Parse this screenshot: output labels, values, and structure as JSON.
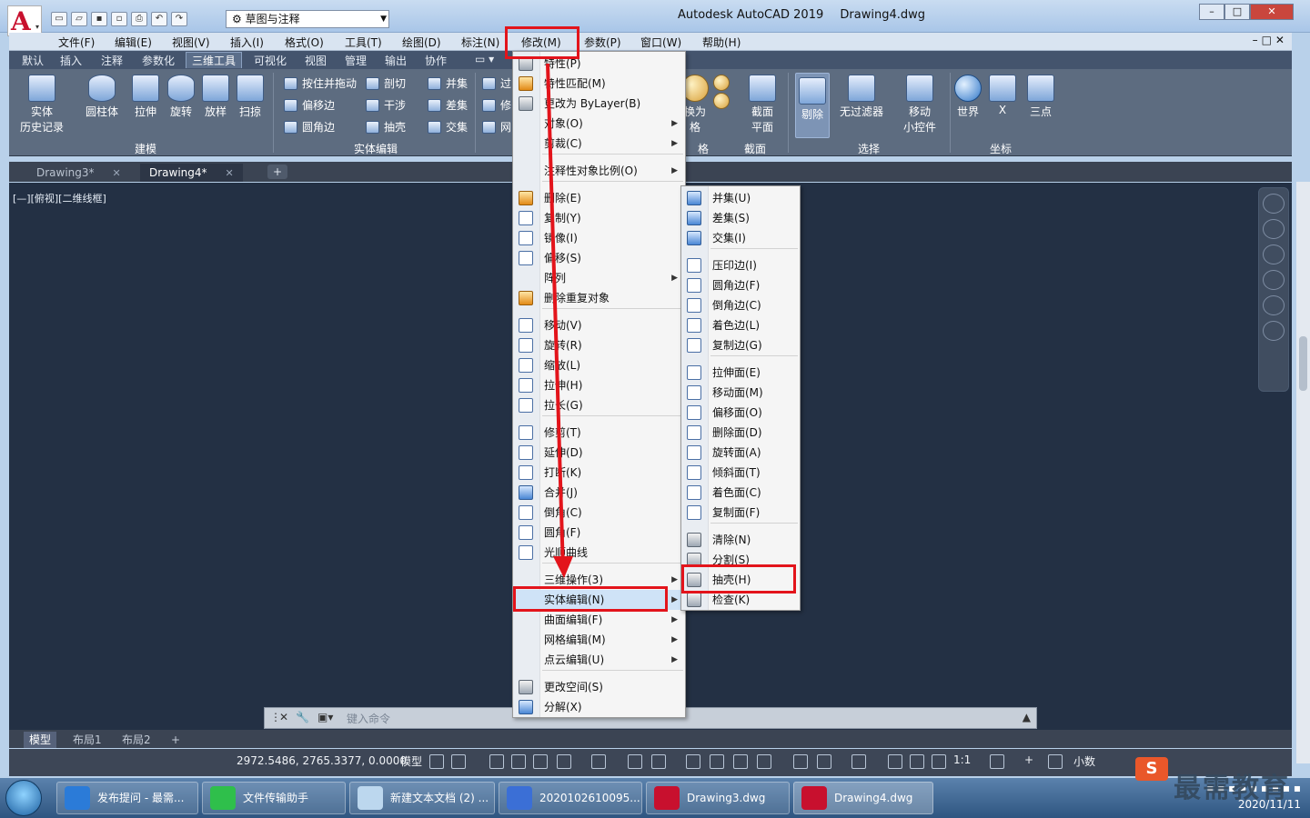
{
  "title_bar": {
    "workspace": "草图与注释",
    "app_title": "Autodesk AutoCAD 2019",
    "doc_title": "Drawing4.dwg"
  },
  "menubar": [
    "文件(F)",
    "编辑(E)",
    "视图(V)",
    "插入(I)",
    "格式(O)",
    "工具(T)",
    "绘图(D)",
    "标注(N)",
    "修改(M)",
    "参数(P)",
    "窗口(W)",
    "帮助(H)"
  ],
  "ribbon_tabs": [
    "默认",
    "插入",
    "注释",
    "参数化",
    "三维工具",
    "可视化",
    "视图",
    "管理",
    "输出",
    "协作"
  ],
  "ribbon": {
    "buttons": {
      "history": "实体\n历史记录",
      "cylinder": "圆柱体",
      "extrude": "拉伸",
      "revolve": "旋转",
      "loft": "放样",
      "sweep": "扫掠",
      "section_plane": "截面\n平面",
      "cull": "剔除",
      "no_filter": "无过滤器",
      "move_gizmo": "移动\n小控件",
      "world": "世界",
      "x": "X",
      "three_point": "三点",
      "convert_partial": "换为\n格"
    },
    "small": {
      "presspull": "按住并拖动",
      "offset_edge": "偏移边",
      "fillet_edge": "圆角边",
      "slice": "剖切",
      "interfere": "干涉",
      "shell": "抽壳",
      "union": "并集",
      "subtract": "差集",
      "intersect": "交集",
      "extract_a": "过",
      "extract_b": "修",
      "extract_c": "网"
    },
    "panels": {
      "modeling": "建模",
      "solid_edit": "实体编辑",
      "grid": "格",
      "section": "截面",
      "selection": "选择",
      "coordinates": "坐标"
    }
  },
  "doc_tabs": [
    "Drawing3*",
    "Drawing4*"
  ],
  "view_label": "[—][俯视][二维线框]",
  "modify_menu": [
    {
      "label": "特性(P)",
      "arrow": false
    },
    {
      "label": "特性匹配(M)",
      "arrow": false
    },
    {
      "label": "更改为 ByLayer(B)",
      "arrow": false
    },
    {
      "label": "对象(O)",
      "arrow": true
    },
    {
      "label": "剪裁(C)",
      "arrow": true
    },
    {
      "label": "注释性对象比例(O)",
      "arrow": true
    },
    {
      "label": "删除(E)",
      "arrow": false
    },
    {
      "label": "复制(Y)",
      "arrow": false
    },
    {
      "label": "镜像(I)",
      "arrow": false
    },
    {
      "label": "偏移(S)",
      "arrow": false
    },
    {
      "label": "阵列",
      "arrow": true
    },
    {
      "label": "删除重复对象",
      "arrow": false
    },
    {
      "label": "移动(V)",
      "arrow": false
    },
    {
      "label": "旋转(R)",
      "arrow": false
    },
    {
      "label": "缩放(L)",
      "arrow": false
    },
    {
      "label": "拉伸(H)",
      "arrow": false
    },
    {
      "label": "拉长(G)",
      "arrow": false
    },
    {
      "label": "修剪(T)",
      "arrow": false
    },
    {
      "label": "延伸(D)",
      "arrow": false
    },
    {
      "label": "打断(K)",
      "arrow": false
    },
    {
      "label": "合并(J)",
      "arrow": false
    },
    {
      "label": "倒角(C)",
      "arrow": false
    },
    {
      "label": "圆角(F)",
      "arrow": false
    },
    {
      "label": "光顺曲线",
      "arrow": false
    },
    {
      "label": "三维操作(3)",
      "arrow": true
    },
    {
      "label": "实体编辑(N)",
      "arrow": true
    },
    {
      "label": "曲面编辑(F)",
      "arrow": true
    },
    {
      "label": "网格编辑(M)",
      "arrow": true
    },
    {
      "label": "点云编辑(U)",
      "arrow": true
    },
    {
      "label": "更改空间(S)",
      "arrow": false
    },
    {
      "label": "分解(X)",
      "arrow": false
    }
  ],
  "solid_edit_menu": [
    "并集(U)",
    "差集(S)",
    "交集(I)",
    "压印边(I)",
    "圆角边(F)",
    "倒角边(C)",
    "着色边(L)",
    "复制边(G)",
    "拉伸面(E)",
    "移动面(M)",
    "偏移面(O)",
    "删除面(D)",
    "旋转面(A)",
    "倾斜面(T)",
    "着色面(C)",
    "复制面(F)",
    "清除(N)",
    "分割(S)",
    "抽壳(H)",
    "检查(K)"
  ],
  "command_line": {
    "placeholder": "键入命令"
  },
  "layout_tabs": [
    "模型",
    "布局1",
    "布局2"
  ],
  "status": {
    "coords": "2972.5486, 2765.3377, 0.0000",
    "model": "模型",
    "scale": "1:1",
    "units": "小数"
  },
  "taskbar": [
    "发布提问 - 最需...",
    "文件传输助手",
    "新建文本文档 (2) ...",
    "2020102610095...",
    "Drawing3.dwg",
    "Drawing4.dwg"
  ],
  "tray": {
    "date": "2020/11/11"
  },
  "brand": "最需教育",
  "colors": {
    "highlight_box": "#e3141b",
    "viewport_bg": "#233044",
    "ribbon_bg": "#5d6c80"
  }
}
